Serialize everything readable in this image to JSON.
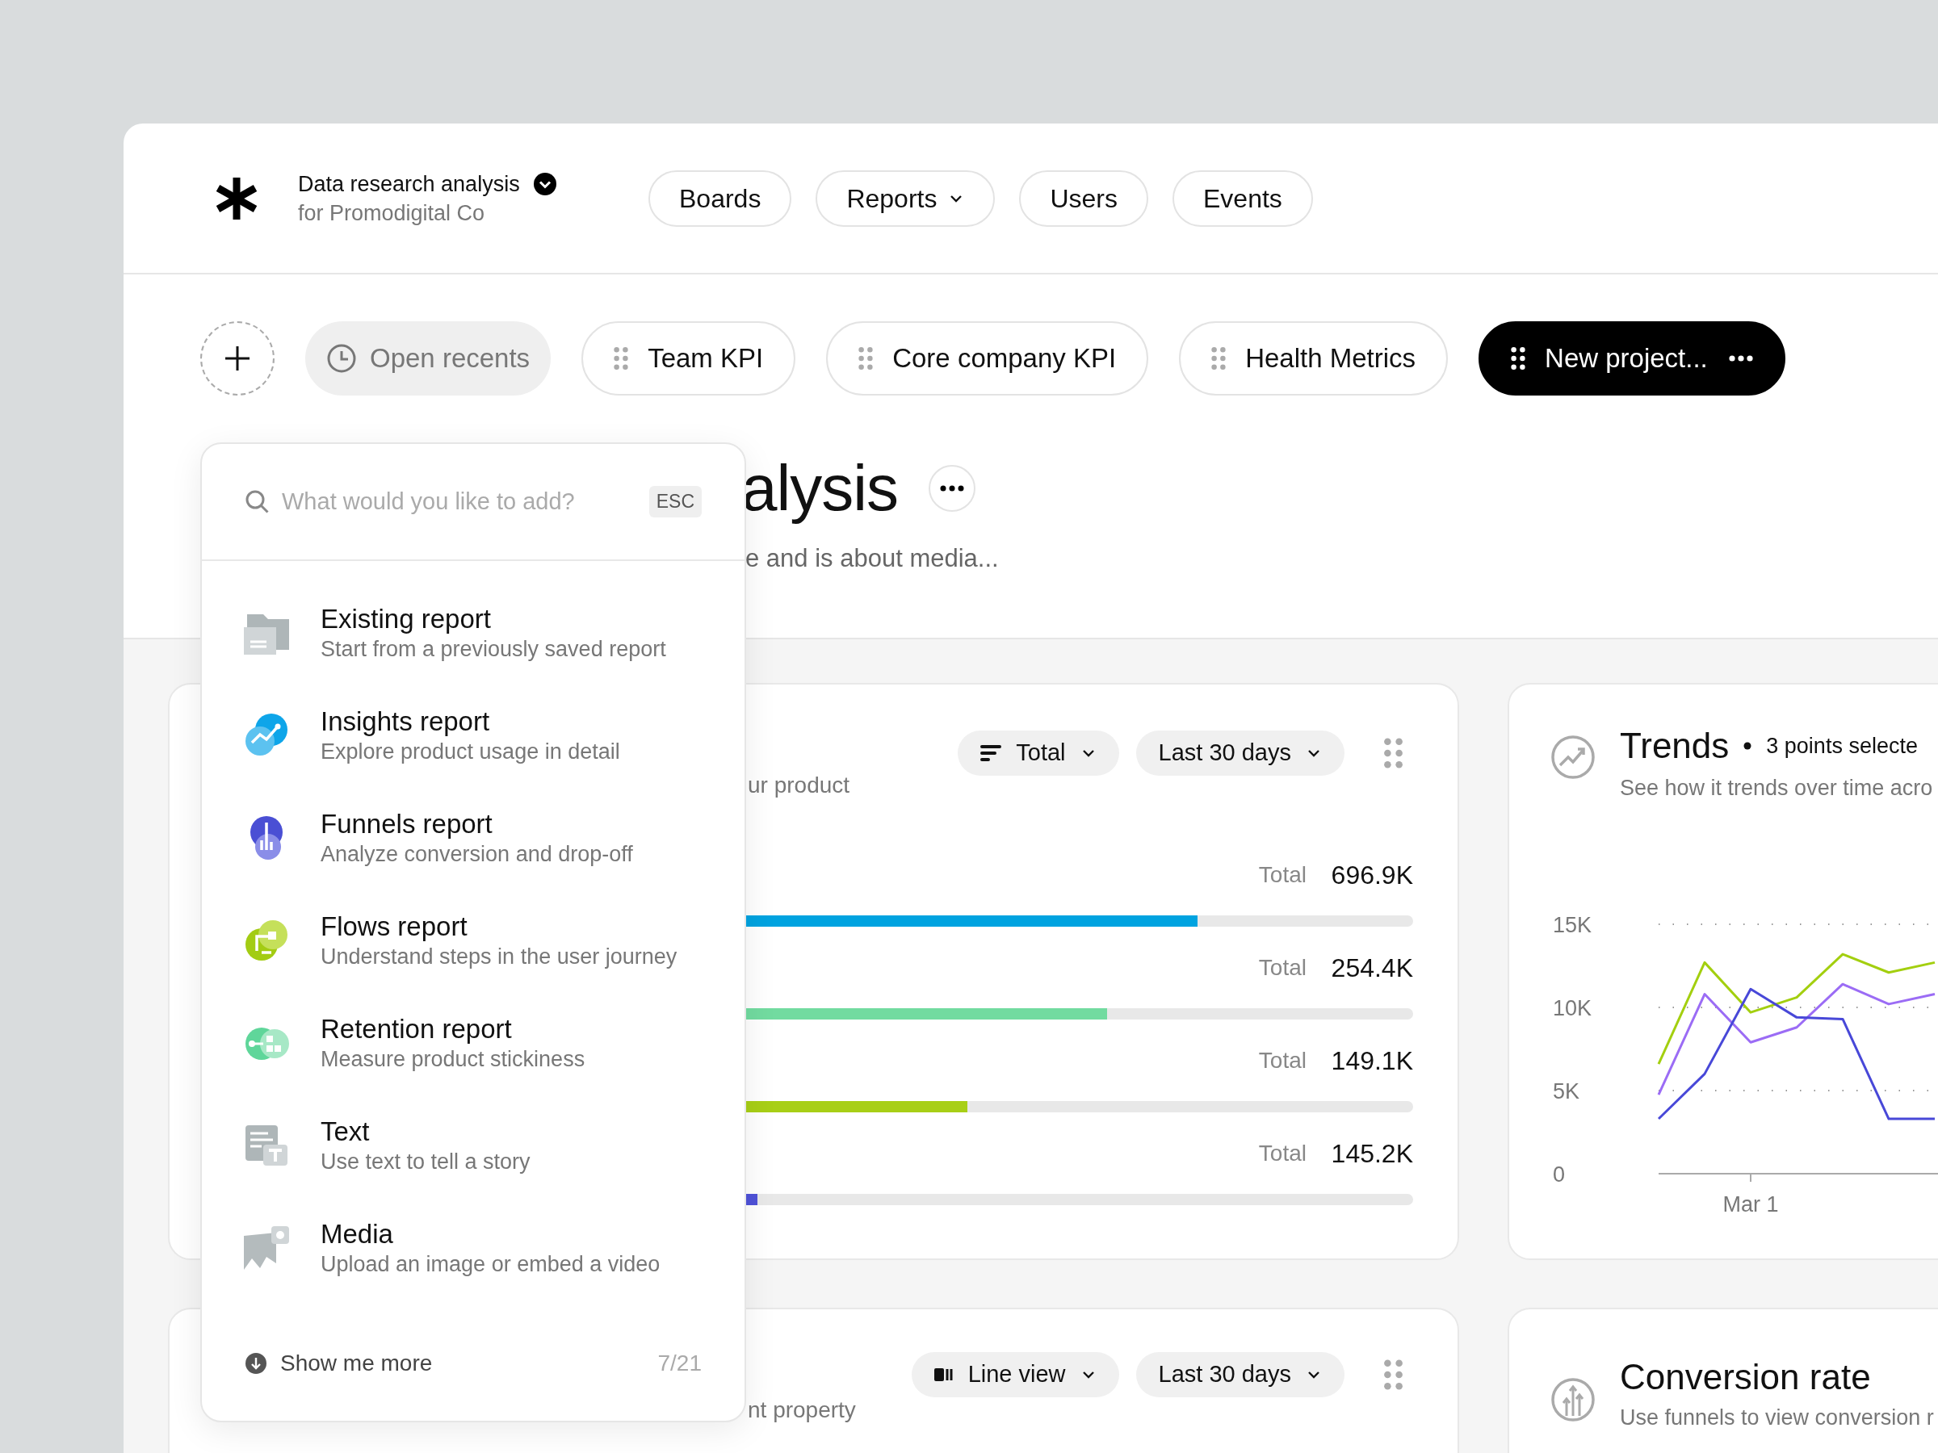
{
  "workspace": {
    "title": "Data research analysis",
    "subtitle": "for Promodigital Co"
  },
  "nav": [
    {
      "label": "Boards",
      "dropdown": false
    },
    {
      "label": "Reports",
      "dropdown": true
    },
    {
      "label": "Users",
      "dropdown": false
    },
    {
      "label": "Events",
      "dropdown": false
    }
  ],
  "tabs": [
    {
      "label": "Open recents",
      "kind": "recents",
      "selected": false
    },
    {
      "label": "Team KPI",
      "kind": "board",
      "selected": false
    },
    {
      "label": "Core company KPI",
      "kind": "board",
      "selected": false
    },
    {
      "label": "Health Metrics",
      "kind": "board",
      "selected": false
    },
    {
      "label": "New project...",
      "kind": "board",
      "selected": true
    }
  ],
  "page": {
    "title": "alysis",
    "subtitle": "e and is about media..."
  },
  "add_menu": {
    "search": {
      "placeholder": "What would you like to add?"
    },
    "shortcut": "ESC",
    "items": [
      {
        "kind": "existing",
        "title": "Existing report",
        "description": "Start from a previously saved report"
      },
      {
        "kind": "insights",
        "title": "Insights report",
        "description": "Explore product usage in detail"
      },
      {
        "kind": "funnels",
        "title": "Funnels report",
        "description": "Analyze conversion and drop-off"
      },
      {
        "kind": "flows",
        "title": "Flows report",
        "description": "Understand steps in the user journey"
      },
      {
        "kind": "retention",
        "title": "Retention report",
        "description": "Measure product stickiness"
      },
      {
        "kind": "text",
        "title": "Text",
        "description": "Use text to tell a story"
      },
      {
        "kind": "media",
        "title": "Media",
        "description": "Upload an image or embed a video"
      }
    ],
    "more": "Show me more",
    "count": "7/21"
  },
  "breakdown_card": {
    "description": "ur product",
    "controls": [
      {
        "kind": "sort",
        "label": "Total"
      },
      {
        "kind": "plain",
        "label": "Last 30 days"
      }
    ],
    "rows": [
      {
        "label": "Total",
        "value": "696.9K",
        "level": 0.82,
        "color": "#00a3e0"
      },
      {
        "label": "Total",
        "value": "254.4K",
        "level": 0.745,
        "color": "#72dba0"
      },
      {
        "label": "Total",
        "value": "149.1K",
        "level": 0.628,
        "color": "#a8cf16"
      },
      {
        "label": "Total",
        "value": "145.2K",
        "level": 0.453,
        "color": "#4f52d8"
      }
    ]
  },
  "trends_card": {
    "title": "Trends",
    "selection": "3 points selecte",
    "description": "See how it trends over time acro",
    "date_label": "Mar 1",
    "chart_data": {
      "type": "line",
      "ylim": [
        0,
        15000
      ],
      "yticks": [
        {
          "value": 0,
          "label": "0"
        },
        {
          "value": 5000,
          "label": "5K"
        },
        {
          "value": 10000,
          "label": "10K"
        },
        {
          "value": 15000,
          "label": "15K"
        }
      ],
      "series": [
        {
          "color": "#a3cf0f",
          "values": [
            6600,
            12700,
            9700,
            10600,
            13200,
            12100,
            12700
          ]
        },
        {
          "color": "#9b6cf5",
          "values": [
            4750,
            10800,
            7900,
            8800,
            11400,
            10200,
            10800
          ]
        },
        {
          "color": "#4848d8",
          "values": [
            3300,
            6000,
            11100,
            9400,
            9300,
            3300,
            3300
          ]
        }
      ]
    }
  },
  "line_card": {
    "description": "nt property",
    "controls": [
      {
        "kind": "view",
        "label": "Line view"
      },
      {
        "kind": "plain",
        "label": "Last 30 days"
      }
    ]
  },
  "conversion_card": {
    "title": "Conversion rate",
    "description": "Use funnels to view conversion r"
  }
}
